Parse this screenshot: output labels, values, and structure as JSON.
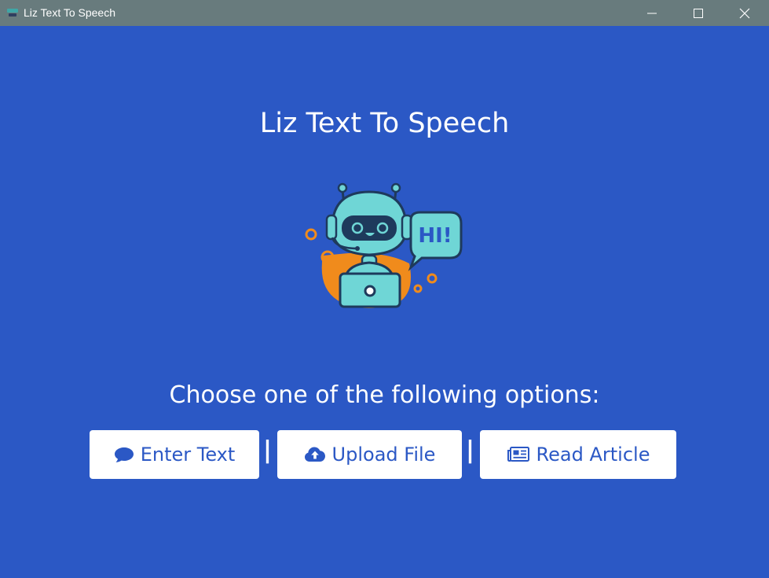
{
  "window": {
    "title": "Liz Text To Speech",
    "controls": [
      "minimize",
      "maximize",
      "close"
    ]
  },
  "main": {
    "title": "Liz Text To Speech",
    "illustration": {
      "icon": "robot-with-laptop-icon",
      "speech_bubble_text": "HI!"
    },
    "prompt": "Choose one of the following options:",
    "separator": "|",
    "options": [
      {
        "label": "Enter Text",
        "icon": "comment-icon"
      },
      {
        "label": "Upload File",
        "icon": "cloud-upload-icon"
      },
      {
        "label": "Read Article",
        "icon": "newspaper-icon"
      }
    ]
  },
  "colors": {
    "background": "#2b58c5",
    "titlebar": "#687b7d",
    "button_bg": "#ffffff",
    "button_text": "#2b58c5",
    "robot_accent": "#6fd6d6",
    "robot_orange": "#f08b1c"
  }
}
